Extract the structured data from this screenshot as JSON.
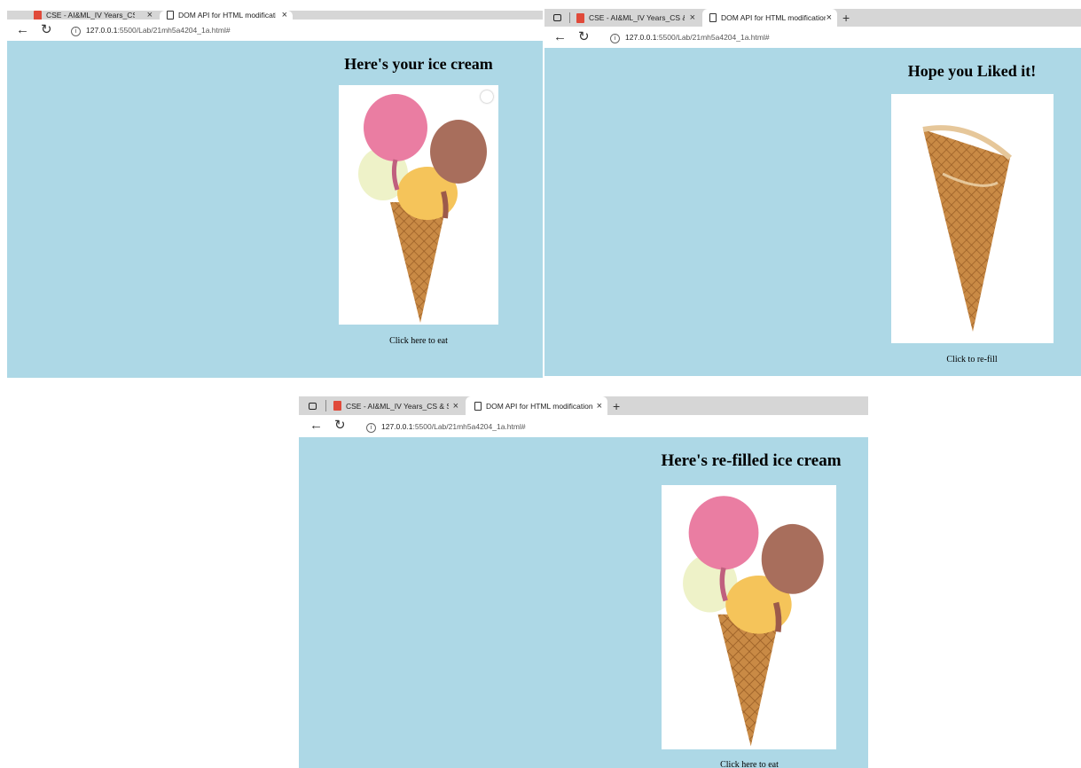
{
  "screenshots": [
    {
      "tabs": [
        {
          "label": "CSE - AI&ML_IV Years_CS & Sylla",
          "icon": "pdf-icon"
        },
        {
          "label": "DOM API for HTML modification",
          "icon": "page-icon"
        }
      ],
      "url_host": "127.0.0.1",
      "url_rest": ":5500/Lab/21mh5a4204_1a.html#",
      "heading": "Here's your ice cream",
      "image": "ice-cream-full",
      "action": "Click here to eat"
    },
    {
      "tabs": [
        {
          "label": "CSE - AI&ML_IV Years_CS & Sylla",
          "icon": "pdf-icon"
        },
        {
          "label": "DOM API for HTML modification",
          "icon": "page-icon"
        }
      ],
      "url_host": "127.0.0.1",
      "url_rest": ":5500/Lab/21mh5a4204_1a.html#",
      "heading": "Hope you Liked it!",
      "image": "empty-cone",
      "action": "Click to re-fill"
    },
    {
      "tabs": [
        {
          "label": "CSE - AI&ML_IV Years_CS & Sylla",
          "icon": "pdf-icon"
        },
        {
          "label": "DOM API for HTML modification",
          "icon": "page-icon"
        }
      ],
      "url_host": "127.0.0.1",
      "url_rest": ":5500/Lab/21mh5a4204_1a.html#",
      "heading": "Here's re-filled ice cream",
      "image": "ice-cream-full",
      "action": "Click here to eat"
    }
  ],
  "colors": {
    "page_bg": "#add8e6",
    "tabbar_bg": "#d6d6d6"
  }
}
